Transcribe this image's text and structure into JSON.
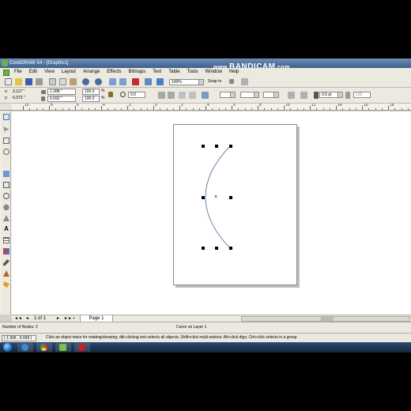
{
  "window": {
    "title": "CorelDRAW X4 - [Graphic1]",
    "watermark_www": "www.",
    "watermark_brand": "BANDICAM",
    "watermark_suffix": ".com"
  },
  "menu": {
    "items": [
      "File",
      "Edit",
      "View",
      "Layout",
      "Arrange",
      "Effects",
      "Bitmaps",
      "Text",
      "Table",
      "Tools",
      "Window",
      "Help"
    ]
  },
  "standard_toolbar": {
    "zoom_value": "100%",
    "snap_to_label": "Snap to"
  },
  "property_bar": {
    "x_label": "x:",
    "x_value": "3.117 \"",
    "y_label": "y:",
    "y_value": "6.073 \"",
    "width_value": "1.388 \"",
    "height_value": "6.692 \"",
    "scale_x": "100.0",
    "scale_y": "100.0",
    "percent_x": "%",
    "percent_y": "%",
    "rotation_value": "0.0",
    "outline_width": "0.5 pt",
    "smoothing_value": "100"
  },
  "ruler": {
    "labels": [
      "10",
      "8",
      "6",
      "4",
      "2",
      "0",
      "2",
      "4",
      "6",
      "8",
      "10",
      "12",
      "14",
      "16",
      "18"
    ]
  },
  "page_nav": {
    "page_count": "1 of 1",
    "page_tab": "Page 1"
  },
  "status": {
    "nodes": "Number of Nodes: 2",
    "object_info": "Curve on Layer 1",
    "coordinates": "( 1.906 , 6.099 )",
    "hint": "Click an object twice for rotating/skewing; dbl-clicking tool selects all objects; Shift+click multi-selects; Alt+click digs; Ctrl+click selects in a group"
  },
  "colors": {
    "curve": "#5f7fa0",
    "title_bar": "#4a6a96",
    "taskbar": "#1d3553",
    "active_app_icon": "#cc1f1f"
  },
  "icons": {
    "toolbox": [
      "pick-tool-icon",
      "shape-tool-icon",
      "crop-tool-icon",
      "zoom-tool-icon",
      "freehand-tool-icon",
      "smart-fill-icon",
      "rectangle-tool-icon",
      "ellipse-tool-icon",
      "polygon-tool-icon",
      "basic-shapes-icon",
      "text-tool-icon",
      "table-tool-icon",
      "interactive-blend-icon",
      "eyedropper-icon",
      "outline-pen-icon",
      "fill-tool-icon"
    ],
    "taskbar": [
      "ie-icon",
      "chrome-icon",
      "coreldraw-icon",
      "bandicam-icon"
    ]
  }
}
